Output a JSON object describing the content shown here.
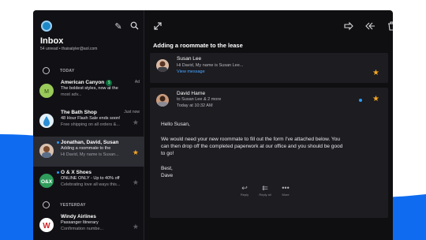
{
  "colors": {
    "accent_blue": "#0f6cf0",
    "star": "#f5a623",
    "link": "#4aa7ff",
    "unread_dot": "#2b9bf4"
  },
  "toolbar_left": {
    "compose_icon": "pencil-icon",
    "search_icon": "search-icon"
  },
  "inbox": {
    "title": "Inbox",
    "subtitle": "54 unread • thaisatyler@aol.com"
  },
  "sections": {
    "today": "TODAY",
    "yesterday": "YESTERDAY"
  },
  "messages": [
    {
      "sender": "American Canyon",
      "line1": "The boldest styles, now at the",
      "line2": "most adv...",
      "date": "Ad",
      "starred": false,
      "badge": "$"
    },
    {
      "sender": "The Bath Shop",
      "line1": "48 Hour Flash Sale ends soon!",
      "line2": "Free shipping on all orders &...",
      "date": "Just now",
      "starred": false
    },
    {
      "sender": "Jonathan, David, Susan",
      "line1": "Adding a roommate to the",
      "line2": "Hi David, My name is Susan...",
      "date": "",
      "starred": true,
      "unread": true
    },
    {
      "sender": "O & X Shoes",
      "line1": "ONLINE ONLY - Up to 40% off",
      "line2": "Celebrating love all ways this...",
      "date": "",
      "starred": false,
      "unread": true
    },
    {
      "sender": "Windy Airlines",
      "line1": "Passanger Itinerary",
      "line2": "Confirmation numbe...",
      "date": "",
      "starred": false
    }
  ],
  "thread": {
    "subject": "Adding a roommate to the lease",
    "first": {
      "name": "Susan Lee",
      "snippet": "Hi David, My name is Susan Lee...",
      "link": "View message"
    },
    "second": {
      "name": "David Harne",
      "to": "to Susan Lee & 2 more",
      "time": "Today at 10:32 AM",
      "body": [
        "Hello Susan,",
        "",
        "We would need your new roommate to fill out the form I've attached below. You",
        "can then drop off the completed paperwork at our office and you should be good",
        "to go!",
        "",
        "Best,",
        "Dave"
      ]
    },
    "actions": {
      "reply": "Reply",
      "reply_all": "Reply all",
      "more": "More"
    }
  }
}
